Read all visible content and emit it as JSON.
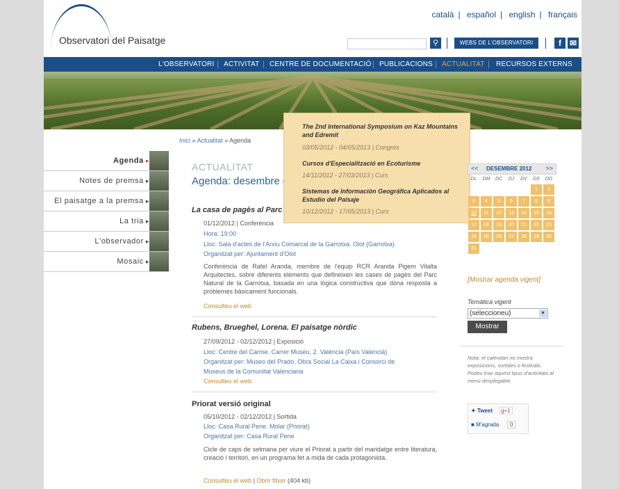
{
  "header": {
    "logo_text": "Observatori del Paisatge",
    "languages": [
      "català",
      "español",
      "english",
      "français"
    ],
    "webs_button": "WEBS DE L'OBSERVATORI",
    "search_icon": "magnifier-icon"
  },
  "nav": {
    "items": [
      "L'OBSERVATORI",
      "ACTIVITAT",
      "CENTRE DE DOCUMENTACIÓ",
      "PUBLICACIONS",
      "ACTUALITAT",
      "RECURSOS EXTERNS"
    ],
    "active": "ACTUALITAT",
    "accent_color": "#1b4e86",
    "active_color": "#e0a64b"
  },
  "breadcrumb": {
    "home": "Inici",
    "section": "Actualitat",
    "current": "Agenda",
    "separator": "»"
  },
  "sidebar": {
    "items": [
      "Agenda",
      "Notes de premsa",
      "El paisatge a la premsa",
      "La tria",
      "L'observador",
      "Mosaic"
    ],
    "active": "Agenda"
  },
  "popup": {
    "events": [
      {
        "title": "The 2nd International Symposium on Kaz Mountains and Edremit",
        "meta": "03/05/2012 - 04/05/2013 | Congrés"
      },
      {
        "title": "Cursos d'Especialització en Ecoturisme",
        "meta": "14/11/2012 - 27/03/2013 | Curs"
      },
      {
        "title": "Sistemas de Información Geográfica Aplicados al Estudio del Paisaje",
        "meta": "10/12/2012 - 17/05/2013 | Curs"
      }
    ]
  },
  "main": {
    "section_label": "ACTUALITAT",
    "heading": "Agenda: desembre d",
    "events": [
      {
        "title": "La casa de pagès al Parc N",
        "line1": "01/12/2012 | Conferència",
        "line2": "Hora: 19:00",
        "line3": "Lloc: Sala d'actes de l'Arxiu Comarcal de la Garrotxa. Olot (Garrotxa)",
        "line4": "Organitzat per: Ajuntament d'Olot",
        "desc": "Conferència de Rafel Aranda, membre de l'equip RCR Aranda Pigem Vilalta Arquitectes, sobre diferents elements que defineixen les cases de pagès del Parc Natural de la Garrotxa, basada en una lògica constructiva que dóna resposta a problemes bàsicament funcionals.",
        "link": "Consulteu el web"
      },
      {
        "title": "Rubens, Brueghel, Lorena. El paisatge nòrdic",
        "line1": "27/09/2012 - 02/12/2012 | Exposició",
        "line2": "Lloc: Centre del Carme. Carrer Museu, 2. València (País Valencià)",
        "line3": "Organitzat per: Museo del Prado, Obra Social La Caixa i Consorci de",
        "line4": "Museus de la Comunitat Valenciana",
        "link": "Consulteu el web"
      },
      {
        "title": "Priorat versió original",
        "line1": "05/10/2012 - 02/12/2012 | Sortida",
        "line2": "Lloc: Casa Rural Pene. Molar (Priorat)",
        "line3": "Organitzat per: Casa Rural Pene",
        "desc": "Cicle de caps de setmana per viure el Priorat a partir del maridatge entre literatura, creació i territori, en un programa fet a mida de cada protagonista.",
        "link": "Consulteu el web",
        "link2": "Obrir fitxer",
        "size": "(404 kb)"
      }
    ]
  },
  "calendar": {
    "month": "DESEMBRE 2012",
    "prev": "<<",
    "next": ">>",
    "day_names": [
      "DL",
      "DM",
      "DC",
      "DJ",
      "DV",
      "DS",
      "DG"
    ],
    "weeks": [
      [
        "",
        "",
        "",
        "",
        "",
        "1",
        "2"
      ],
      [
        "3",
        "4",
        "5",
        "6",
        "7",
        "8",
        "9"
      ],
      [
        "10",
        "11",
        "12",
        "13",
        "14",
        "15",
        "16"
      ],
      [
        "17",
        "18",
        "19",
        "20",
        "21",
        "22",
        "23"
      ],
      [
        "24",
        "25",
        "26",
        "27",
        "28",
        "29",
        "30"
      ],
      [
        "31",
        "",
        "",
        "",
        "",
        "",
        ""
      ]
    ],
    "cell_color": "#f0c06a"
  },
  "right": {
    "show_current": "[Mostrar agenda vigent]",
    "topic_label": "Temàtica vigent",
    "topic_value": "(seleccioneu)",
    "show_button": "Mostrar",
    "note": "Nota: el calendari no mostra exposicions, sortides o festivals. Podeu triar aquest tipus d'activitats al menú desplegable.",
    "tweet": "Tweet",
    "gplus": "+1",
    "like": "M'agrada",
    "like_count": "0"
  }
}
